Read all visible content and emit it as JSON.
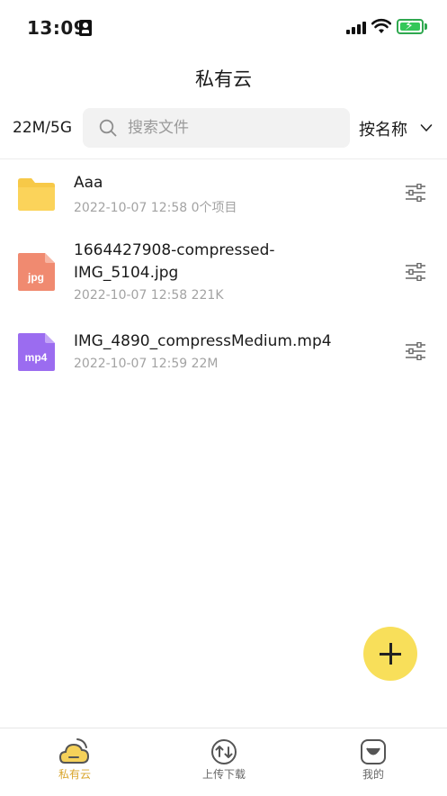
{
  "status_bar": {
    "time": "13:09"
  },
  "header": {
    "title": "私有云"
  },
  "toolbar": {
    "storage_usage": "22M/5G",
    "search_placeholder": "搜索文件",
    "sort_label": "按名称"
  },
  "files": [
    {
      "name": "Aaa",
      "meta": "2022-10-07 12:58 0个项目",
      "type": "folder"
    },
    {
      "name": "1664427908-compressed-IMG_5104.jpg",
      "meta": "2022-10-07 12:58 221K",
      "type": "jpg",
      "badge": "jpg"
    },
    {
      "name": "IMG_4890_compressMedium.mp4",
      "meta": "2022-10-07 12:59 22M",
      "type": "mp4",
      "badge": "mp4"
    }
  ],
  "tabs": [
    {
      "label": "私有云",
      "active": true
    },
    {
      "label": "上传下载",
      "active": false
    },
    {
      "label": "我的",
      "active": false
    }
  ],
  "colors": {
    "accent": "#f8df5a",
    "active_tab": "#d9a52b",
    "folder": "#f7c948",
    "jpg": "#f08a70",
    "mp4": "#9b6cf0"
  }
}
